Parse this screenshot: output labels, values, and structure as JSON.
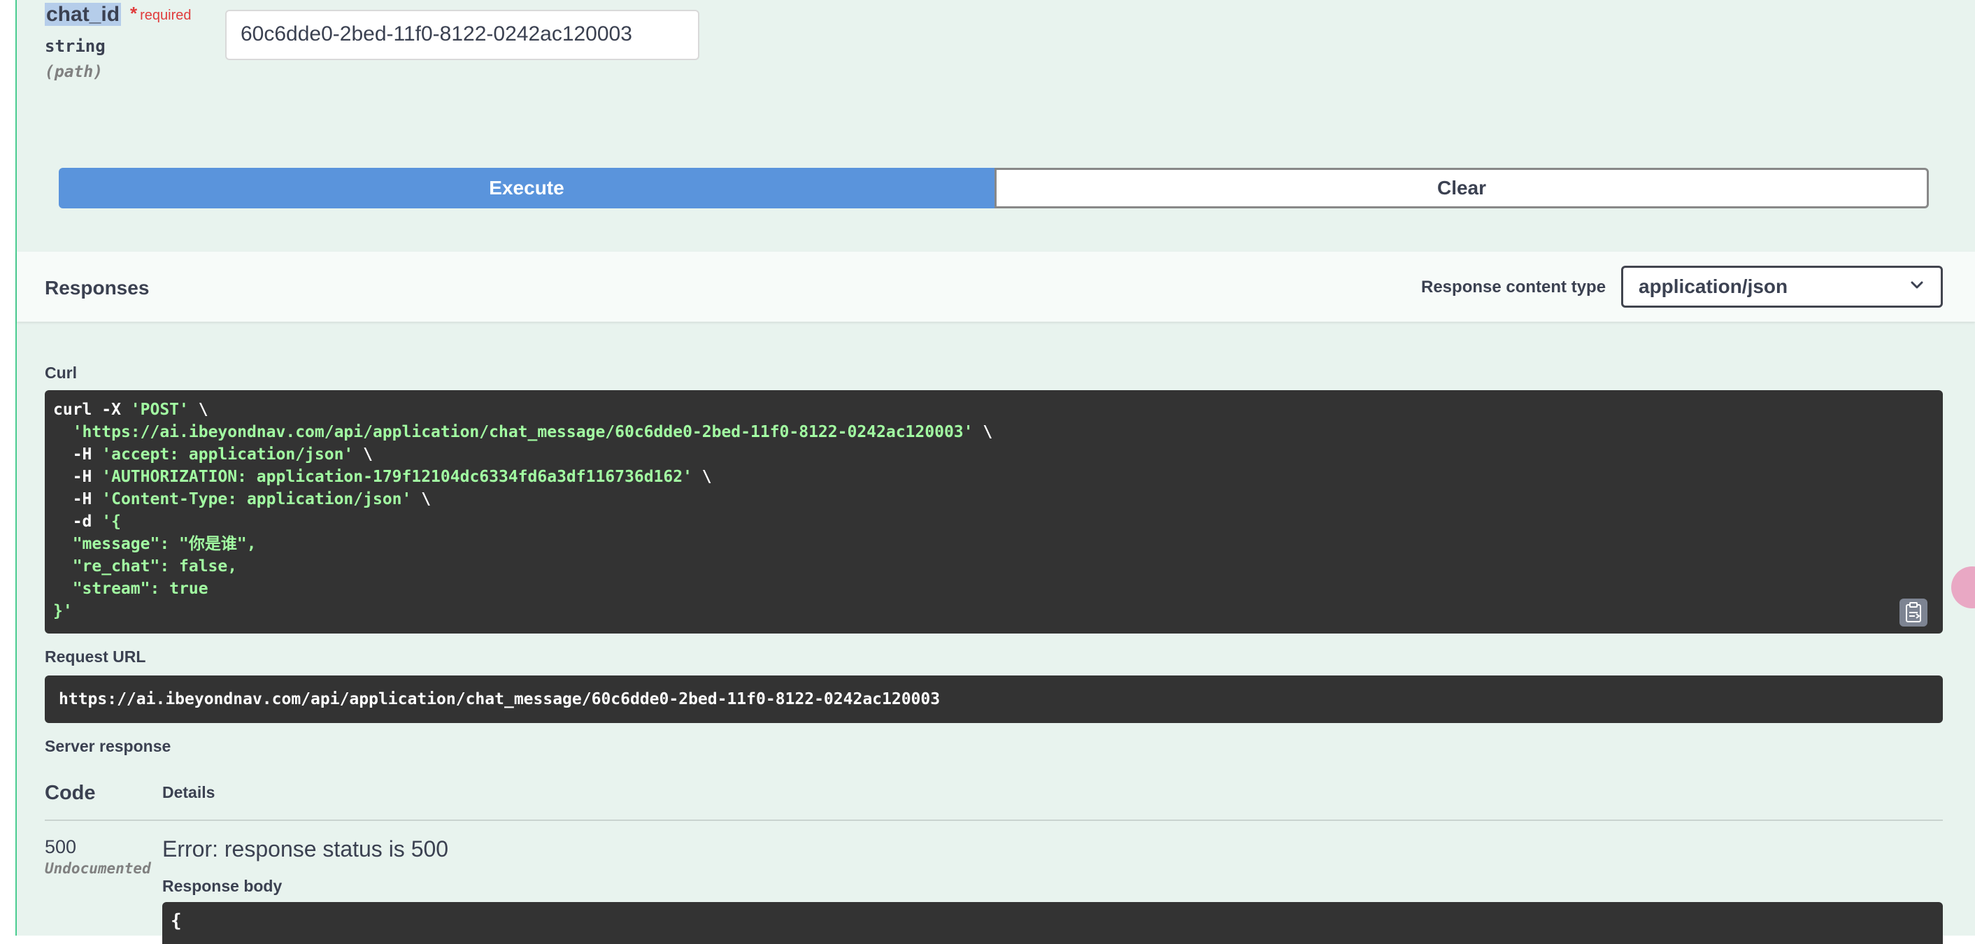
{
  "parameter": {
    "name": "chat_id",
    "required_mark": "*",
    "required_label": "required",
    "type": "string",
    "location": "(path)",
    "value": "60c6dde0-2bed-11f0-8122-0242ac120003"
  },
  "buttons": {
    "execute_label": "Execute",
    "clear_label": "Clear"
  },
  "responses": {
    "title": "Responses",
    "content_type_label": "Response content type",
    "content_type_value": "application/json"
  },
  "curl": {
    "label": "Curl",
    "lines": [
      {
        "plain": "curl -X ",
        "str": "'POST'",
        "tail": " \\"
      },
      {
        "plain": "  ",
        "str": "'https://ai.ibeyondnav.com/api/application/chat_message/60c6dde0-2bed-11f0-8122-0242ac120003'",
        "tail": " \\"
      },
      {
        "plain": "  -H ",
        "str": "'accept: application/json'",
        "tail": " \\"
      },
      {
        "plain": "  -H ",
        "str": "'AUTHORIZATION: application-179f12104dc6334fd6a3df116736d162'",
        "tail": " \\"
      },
      {
        "plain": "  -H ",
        "str": "'Content-Type: application/json'",
        "tail": " \\"
      },
      {
        "plain": "  -d ",
        "str": "'{",
        "tail": ""
      },
      {
        "plain": "",
        "str": "  \"message\": \"你是谁\",",
        "tail": ""
      },
      {
        "plain": "",
        "str": "  \"re_chat\": false,",
        "tail": ""
      },
      {
        "plain": "",
        "str": "  \"stream\": true",
        "tail": ""
      },
      {
        "plain": "",
        "str": "}'",
        "tail": ""
      }
    ]
  },
  "request_url": {
    "label": "Request URL",
    "value": "https://ai.ibeyondnav.com/api/application/chat_message/60c6dde0-2bed-11f0-8122-0242ac120003"
  },
  "server_response": {
    "label": "Server response",
    "code_header": "Code",
    "details_header": "Details",
    "code": "500",
    "code_note": "Undocumented",
    "error_message": "Error: response status is 500",
    "body_label": "Response body",
    "body_text": "{"
  },
  "icons": {
    "copy": "clipboard-icon",
    "dropdown": "chevron-down-icon"
  },
  "colors": {
    "block_bg": "#e8f3ee",
    "block_border": "#49cc90",
    "execute_bg": "#5a94dc",
    "code_bg": "#333333",
    "code_string": "#a2fca2",
    "required": "#e03c3c"
  }
}
